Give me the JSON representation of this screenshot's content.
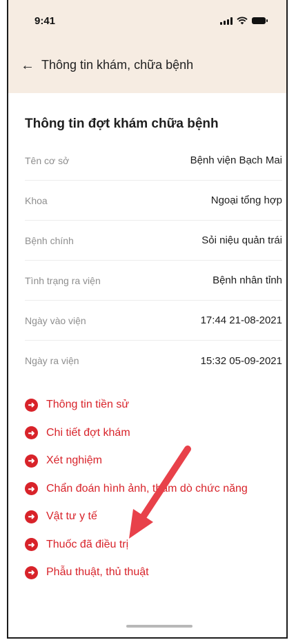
{
  "status_bar": {
    "time": "9:41"
  },
  "header": {
    "title": "Thông tin khám, chữa bệnh",
    "back_icon": "arrow-left-icon"
  },
  "section": {
    "title": "Thông tin đợt khám chữa bệnh",
    "rows": [
      {
        "label": "Tên cơ sở",
        "value": "Bệnh viện Bạch Mai"
      },
      {
        "label": "Khoa",
        "value": "Ngoại tổng hợp"
      },
      {
        "label": "Bệnh chính",
        "value": "Sỏi niệu quản trái"
      },
      {
        "label": "Tình trạng ra viện",
        "value": "Bệnh nhân tỉnh"
      },
      {
        "label": "Ngày vào viện",
        "value": "17:44 21-08-2021"
      },
      {
        "label": "Ngày ra viện",
        "value": "15:32 05-09-2021"
      }
    ]
  },
  "links": [
    {
      "label": "Thông tin tiền sử"
    },
    {
      "label": "Chi tiết đợt khám"
    },
    {
      "label": "Xét nghiệm"
    },
    {
      "label": "Chẩn đoán hình ảnh, thăm dò chức năng"
    },
    {
      "label": "Vật tư y tế"
    },
    {
      "label": "Thuốc đã điều trị"
    },
    {
      "label": "Phẫu thuật, thủ thuật"
    }
  ],
  "colors": {
    "accent": "#d8232a",
    "header_bg": "#f6ece2",
    "annotation_arrow": "#e8414a"
  }
}
